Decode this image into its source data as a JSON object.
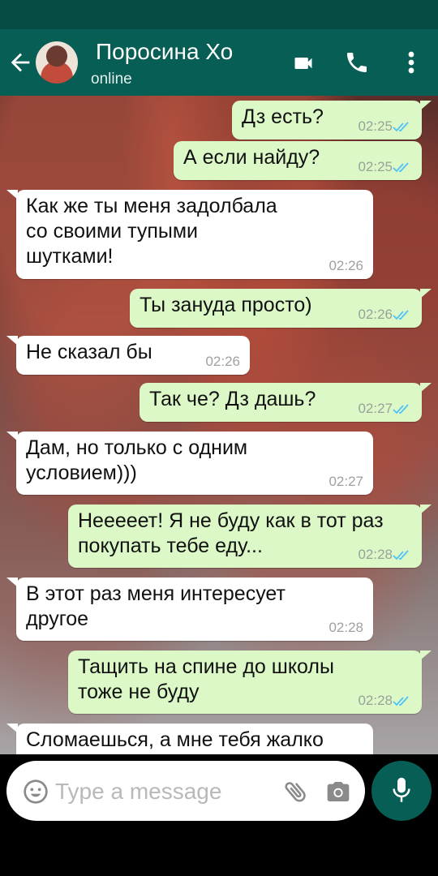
{
  "header": {
    "contact_name": "Поросина Хо",
    "status": "online"
  },
  "messages": [
    {
      "dir": "out",
      "text": "Дз есть?",
      "time": "02:25"
    },
    {
      "dir": "out",
      "text": "А если найду?",
      "time": "02:25"
    },
    {
      "dir": "in",
      "lines": [
        "Как же ты меня задолбала",
        "со своими тупыми",
        "шутками!"
      ],
      "time": "02:26"
    },
    {
      "dir": "out",
      "text": "Ты зануда просто)",
      "time": "02:26"
    },
    {
      "dir": "in",
      "text": "Не сказал бы",
      "time": "02:26"
    },
    {
      "dir": "out",
      "text": "Так че? Дз дашь?",
      "time": "02:27"
    },
    {
      "dir": "in",
      "lines": [
        "Дам, но только с одним",
        "условием)))"
      ],
      "time": "02:27"
    },
    {
      "dir": "out",
      "lines": [
        "Нееееет! Я не буду как в тот раз",
        "покупать тебе еду..."
      ],
      "time": "02:28"
    },
    {
      "dir": "in",
      "lines": [
        "В этот раз меня интересует",
        "другое"
      ],
      "time": "02:28"
    },
    {
      "dir": "out",
      "lines": [
        "Тащить на спине до школы",
        "тоже не буду"
      ],
      "time": "02:28"
    },
    {
      "dir": "in",
      "text": "Сломаешься, а мне тебя жалко"
    }
  ],
  "composer": {
    "placeholder": "Type a message"
  },
  "colors": {
    "header": "#075e54",
    "status_bar": "#054d44",
    "outgoing_bubble": "#dcf8c6",
    "incoming_bubble": "#ffffff",
    "read_ticks": "#4fc3f7"
  },
  "icons": [
    "back-arrow-icon",
    "video-call-icon",
    "phone-icon",
    "menu-icon",
    "emoji-icon",
    "attach-icon",
    "camera-icon",
    "mic-icon",
    "read-ticks-icon"
  ]
}
